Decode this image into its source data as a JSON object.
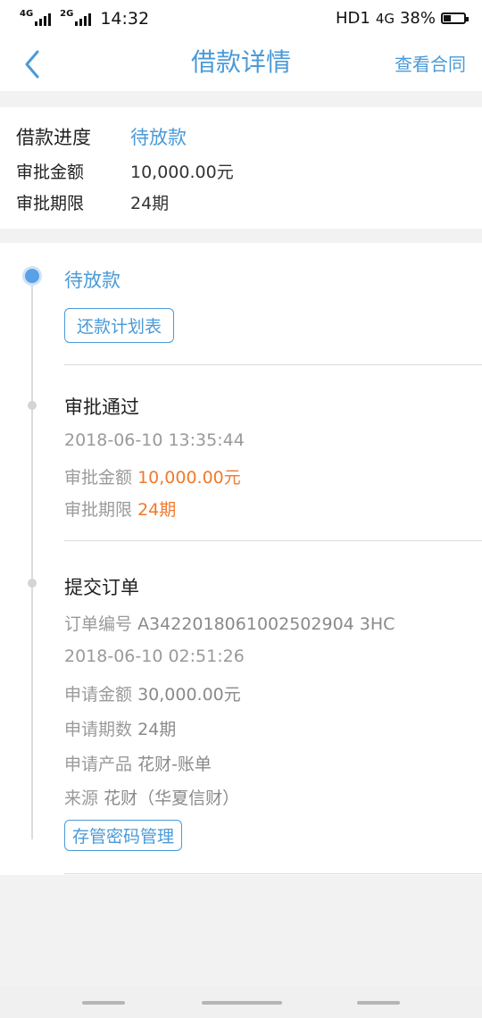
{
  "status_bar": {
    "net1": "4G",
    "net2": "2G",
    "time": "14:32",
    "hd": "HD1",
    "net3": "4G",
    "battery": "38%",
    "battery_level": 0.38
  },
  "header": {
    "title": "借款详情",
    "contract_link": "查看合同"
  },
  "summary": {
    "progress_label": "借款进度",
    "progress_value": "待放款",
    "amount_label": "审批金额",
    "amount_value": "10,000.00元",
    "term_label": "审批期限",
    "term_value": "24期"
  },
  "timeline": {
    "step1": {
      "title": "待放款",
      "button": "还款计划表"
    },
    "step2": {
      "title": "审批通过",
      "datetime": "2018-06-10 13:35:44",
      "amount_label": "审批金额",
      "amount_value": "10,000.00元",
      "term_label": "审批期限",
      "term_value": "24期"
    },
    "step3": {
      "title": "提交订单",
      "order_label": "订单编号",
      "order_value": "A3422018061002502904 3HC",
      "datetime": "2018-06-10 02:51:26",
      "amount_label": "申请金额",
      "amount_value": "30,000.00元",
      "term_label": "申请期数",
      "term_value": "24期",
      "product_label": "申请产品",
      "product_value": "花财-账单",
      "source_label": "来源",
      "source_value": "花财（华夏信财）",
      "button": "存管密码管理"
    }
  },
  "colors": {
    "accent": "#4a9ad8",
    "highlight": "#f07a2c",
    "background": "#f2f2f2"
  }
}
